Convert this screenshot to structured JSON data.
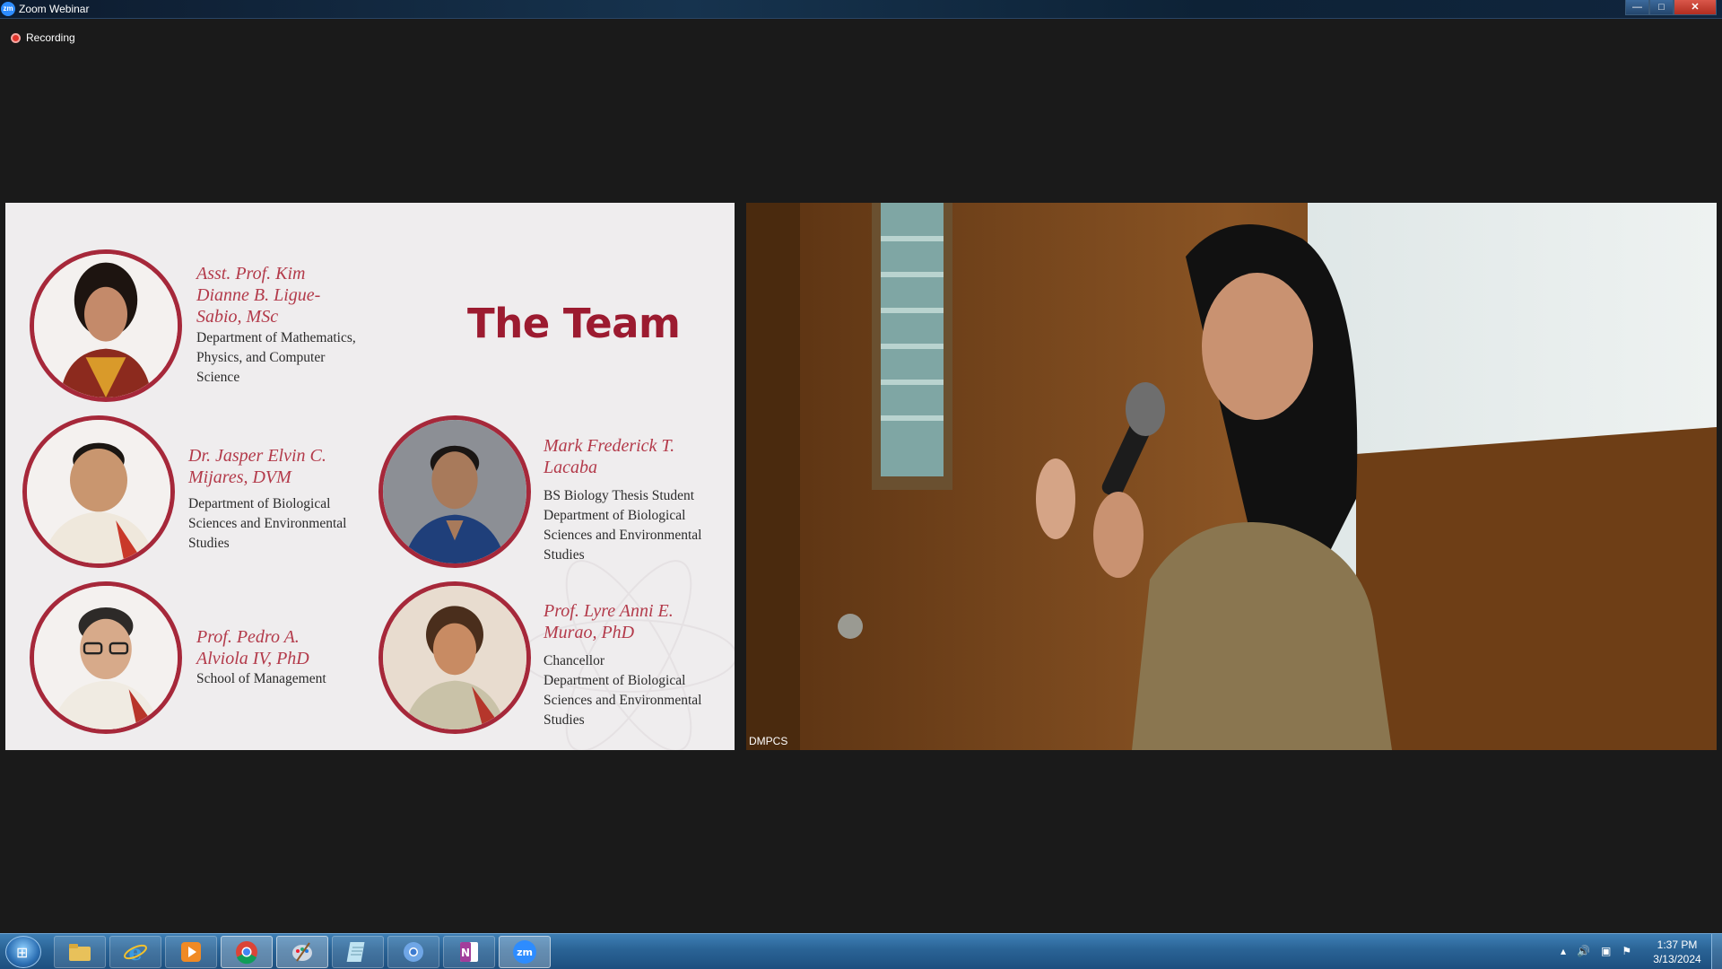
{
  "window": {
    "title": "Zoom Webinar",
    "controls": {
      "minimize": "—",
      "maximize": "□",
      "close": "✕"
    }
  },
  "recording": {
    "label": "Recording",
    "color": "#e0342b"
  },
  "slide": {
    "title": "The Team",
    "accent_color": "#9c1b30",
    "members": [
      {
        "name_lines": [
          "Asst. Prof. Kim",
          "Dianne B. Ligue-",
          "Sabio, MSc"
        ],
        "dept_lines": [
          "Department of Mathematics,",
          "Physics, and Computer",
          "Science"
        ]
      },
      {
        "name_lines": [
          "Dr. Jasper Elvin C.",
          "Mijares, DVM"
        ],
        "dept_lines": [
          "Department of Biological",
          "Sciences and Environmental",
          "Studies"
        ]
      },
      {
        "name_lines": [
          "Mark Frederick T.",
          "Lacaba"
        ],
        "dept_lines": [
          "BS Biology Thesis Student",
          "Department of Biological",
          "Sciences and Environmental",
          "Studies"
        ]
      },
      {
        "name_lines": [
          "Prof. Pedro A.",
          "Alviola IV, PhD"
        ],
        "dept_lines": [
          "School of Management"
        ]
      },
      {
        "name_lines": [
          "Prof. Lyre Anni E.",
          "Murao, PhD"
        ],
        "dept_lines": [
          "Chancellor",
          "Department of Biological",
          "Sciences and Environmental",
          "Studies"
        ]
      }
    ]
  },
  "video": {
    "participant_name": "DMPCS"
  },
  "taskbar": {
    "start_icon": "windows-logo-icon",
    "apps": [
      {
        "name": "file-explorer-icon",
        "color": "#e8c15a"
      },
      {
        "name": "internet-explorer-icon",
        "color": "#3b9ae1"
      },
      {
        "name": "media-player-icon",
        "color": "#f08a24"
      },
      {
        "name": "chrome-icon",
        "color": "#db4437"
      },
      {
        "name": "paint-icon",
        "color": "#cfd8e3"
      },
      {
        "name": "notepad-icon",
        "color": "#bfe3f2"
      },
      {
        "name": "chrome-alt-icon",
        "color": "#6fa6e6"
      },
      {
        "name": "onenote-icon",
        "color": "#a23d9b"
      },
      {
        "name": "zoom-icon",
        "color": "#2d8cff",
        "label": "zm"
      }
    ],
    "tray": {
      "up_arrow": "▴",
      "volume": "🔊",
      "network": "▣",
      "flag": "⚑"
    },
    "time": "1:37 PM",
    "date": "3/13/2024"
  }
}
